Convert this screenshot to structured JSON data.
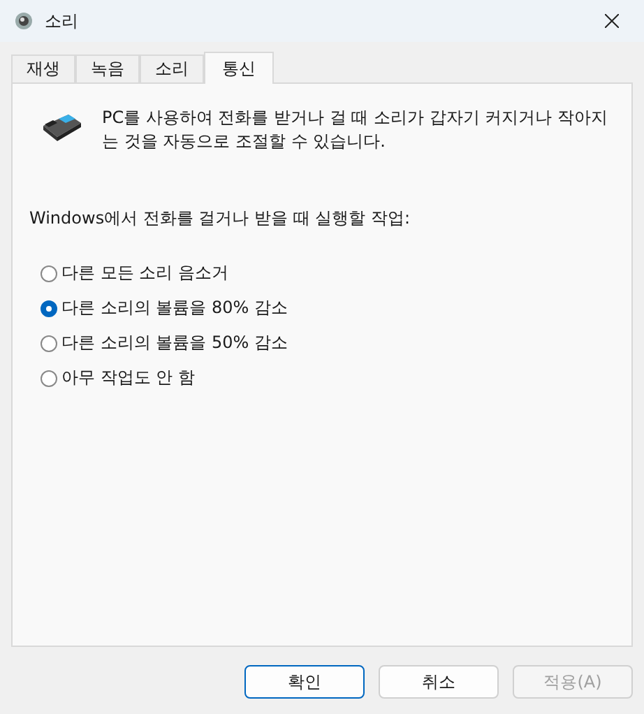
{
  "window": {
    "title": "소리"
  },
  "tabs": [
    {
      "label": "재생",
      "selected": false
    },
    {
      "label": "녹음",
      "selected": false
    },
    {
      "label": "소리",
      "selected": false
    },
    {
      "label": "통신",
      "selected": true
    }
  ],
  "description": "PC를 사용하여 전화를 받거나 걸 때 소리가 갑자기 커지거나 작아지는 것을 자동으로 조절할 수 있습니다.",
  "prompt": "Windows에서 전화를 걸거나 받을 때 실행할 작업:",
  "options": [
    {
      "label": "다른 모든 소리 음소거",
      "selected": false
    },
    {
      "label": "다른 소리의 볼륨을 80% 감소",
      "selected": true
    },
    {
      "label": "다른 소리의 볼륨을 50% 감소",
      "selected": false
    },
    {
      "label": "아무 작업도 안 함",
      "selected": false
    }
  ],
  "buttons": [
    {
      "label": "확인",
      "default": true,
      "disabled": false
    },
    {
      "label": "취소",
      "default": false,
      "disabled": false
    },
    {
      "label": "적용(A)",
      "default": false,
      "disabled": true
    }
  ]
}
